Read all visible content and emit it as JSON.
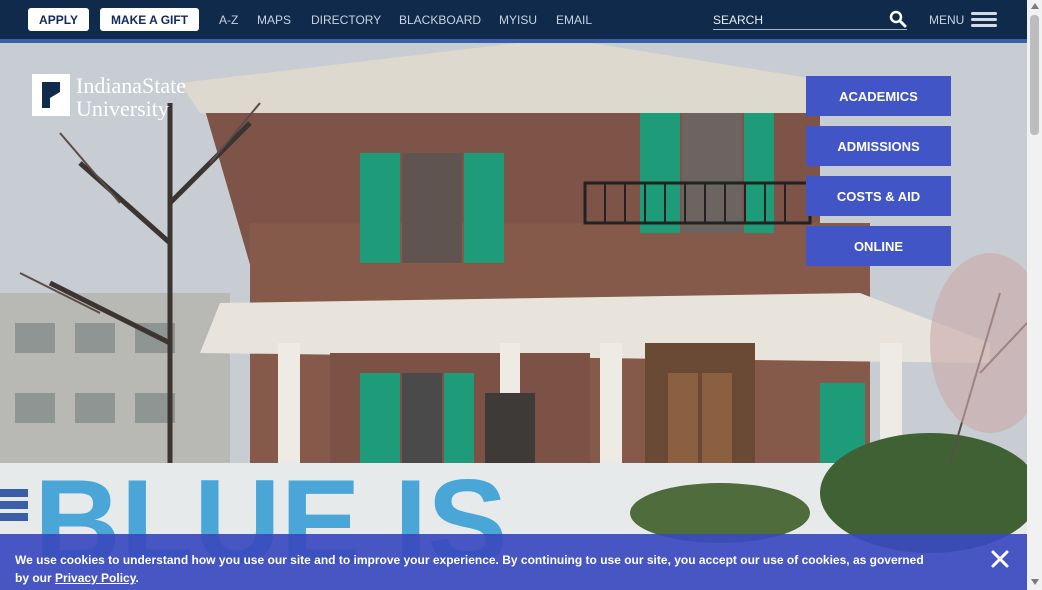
{
  "topbar": {
    "apply_label": "APPLY",
    "gift_label": "MAKE A GIFT",
    "links": [
      "A-Z",
      "MAPS",
      "DIRECTORY",
      "BLACKBOARD",
      "MYISU",
      "EMAIL"
    ],
    "search_placeholder": "SEARCH",
    "menu_label": "MENU"
  },
  "logo": {
    "line1": "IndianaState",
    "line2": "University"
  },
  "sidenav": {
    "items": [
      "ACADEMICS",
      "ADMISSIONS",
      "COSTS & AID",
      "ONLINE"
    ]
  },
  "hero": {
    "headline_partial": "BLUE IS"
  },
  "cookie_banner": {
    "text": "We use cookies to understand how you use our site and to improve your experience. By continuing to use our site, you accept our use of cookies, as governed by our ",
    "link_label": "Privacy Policy",
    "end": "."
  },
  "colors": {
    "topbar": "#0f2a4a",
    "button_blue": "#4155c7",
    "banner": "#3a4abe"
  }
}
